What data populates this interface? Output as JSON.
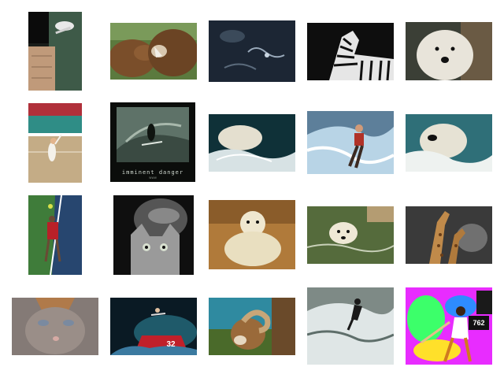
{
  "gallery": {
    "thumbnails": [
      {
        "name": "skateboarder-wall",
        "icon": "skateboard-image",
        "alt": ""
      },
      {
        "name": "bears-fighting",
        "icon": "bear-image",
        "alt": ""
      },
      {
        "name": "dark-water-splash",
        "icon": "water-image",
        "alt": ""
      },
      {
        "name": "zebras",
        "icon": "zebra-image",
        "alt": ""
      },
      {
        "name": "polar-bear-face",
        "icon": "polar-bear-image",
        "alt": ""
      },
      {
        "name": "tennis-player-serve",
        "icon": "tennis-image",
        "alt": ""
      },
      {
        "name": "surfer-poster",
        "icon": "surf-image",
        "alt": "",
        "caption": "imminent danger",
        "subcaption": "www"
      },
      {
        "name": "polar-bear-swimming",
        "icon": "polar-bear-image",
        "alt": ""
      },
      {
        "name": "water-skier",
        "icon": "waterski-image",
        "alt": ""
      },
      {
        "name": "polar-bear-splash",
        "icon": "polar-bear-image",
        "alt": ""
      },
      {
        "name": "tennis-player-court",
        "icon": "tennis-image",
        "alt": ""
      },
      {
        "name": "woman-and-cat",
        "icon": "cat-image",
        "alt": ""
      },
      {
        "name": "polar-bear-rock",
        "icon": "polar-bear-image",
        "alt": ""
      },
      {
        "name": "polar-bear-water",
        "icon": "polar-bear-image",
        "alt": ""
      },
      {
        "name": "giraffes",
        "icon": "giraffe-image",
        "alt": ""
      },
      {
        "name": "cat-closeup",
        "icon": "cat-image",
        "alt": ""
      },
      {
        "name": "snowboarder-jump",
        "icon": "snowboard-image",
        "alt": "",
        "number": "32"
      },
      {
        "name": "bighorn-ram",
        "icon": "ram-image",
        "alt": ""
      },
      {
        "name": "surfer-wave",
        "icon": "surf-image",
        "alt": ""
      },
      {
        "name": "baseball-batter",
        "icon": "baseball-image",
        "alt": "",
        "board": "762"
      }
    ]
  }
}
